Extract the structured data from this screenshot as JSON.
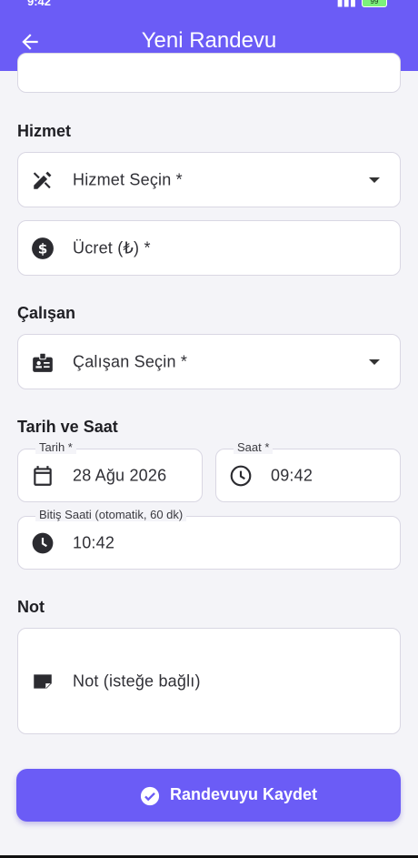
{
  "status_bar": {
    "time": "9:42",
    "battery": "99"
  },
  "app_bar": {
    "title": "Yeni Randevu"
  },
  "sections": {
    "service": "Hizmet",
    "employee": "Çalışan",
    "datetime": "Tarih ve Saat",
    "note": "Not"
  },
  "fields": {
    "service_select": "Hizmet Seçin *",
    "price": "Ücret (₺) *",
    "employee_select": "Çalışan Seçin *",
    "date_label": "Tarih *",
    "date_value": "28 Ağu 2026",
    "time_label": "Saat *",
    "time_value": "09:42",
    "end_label": "Bitiş Saati (otomatik, 60 dk)",
    "end_value": "10:42",
    "note_placeholder": "Not (isteğe bağlı)"
  },
  "actions": {
    "save": "Randevuyu Kaydet"
  },
  "colors": {
    "primary": "#6b5cf6",
    "background": "#f4f4f8"
  }
}
